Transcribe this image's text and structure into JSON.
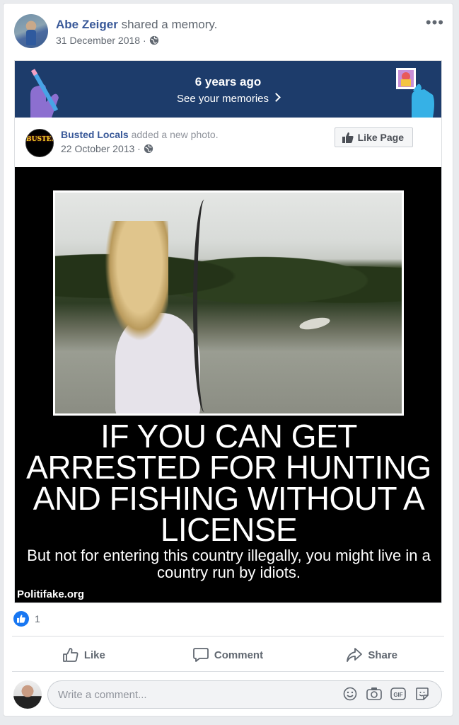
{
  "post": {
    "author": "Abe Zeiger",
    "action": " shared a memory.",
    "date": "31 December 2018 ·",
    "privacy_icon": "globe-icon",
    "menu_icon": "more-dots-icon",
    "menu_label": "•••"
  },
  "memory": {
    "years_ago": "6 years ago",
    "see_memories": "See your memories"
  },
  "original": {
    "page_name": "Busted Locals",
    "action": " added a new photo.",
    "date": "22 October 2013 ·",
    "avatar_text": "BUSTED",
    "like_page_label": "Like Page"
  },
  "meme": {
    "headline": "IF YOU CAN GET ARRESTED FOR HUNTING AND FISHING WITHOUT A LICENSE",
    "subline": "But not for entering this country illegally, you might live in a country run by idiots.",
    "credit": "Politifake.org"
  },
  "reactions": {
    "count": "1"
  },
  "actions": {
    "like": "Like",
    "comment": "Comment",
    "share": "Share"
  },
  "comment_box": {
    "placeholder": "Write a comment..."
  },
  "colors": {
    "brand_blue": "#385898",
    "banner": "#1d3c6b",
    "like_blue": "#1877f2"
  }
}
